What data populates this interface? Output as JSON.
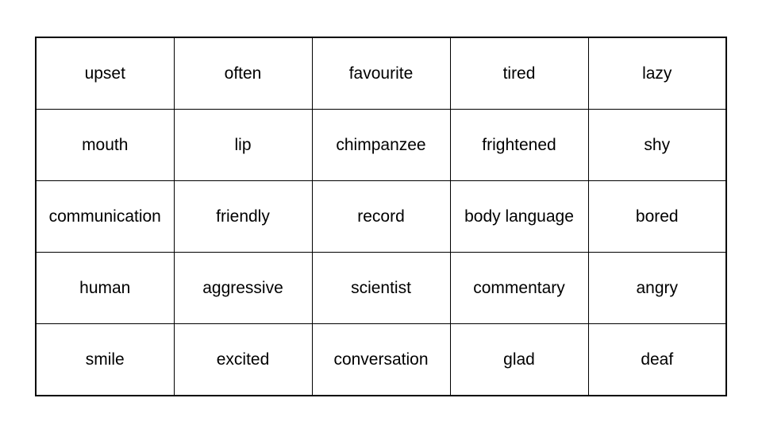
{
  "grid": {
    "rows": [
      [
        "upset",
        "often",
        "favourite",
        "tired",
        "lazy"
      ],
      [
        "mouth",
        "lip",
        "chimpanzee",
        "frightened",
        "shy"
      ],
      [
        "communication",
        "friendly",
        "record",
        "body language",
        "bored"
      ],
      [
        "human",
        "aggressive",
        "scientist",
        "commentary",
        "angry"
      ],
      [
        "smile",
        "excited",
        "conversation",
        "glad",
        "deaf"
      ]
    ]
  }
}
